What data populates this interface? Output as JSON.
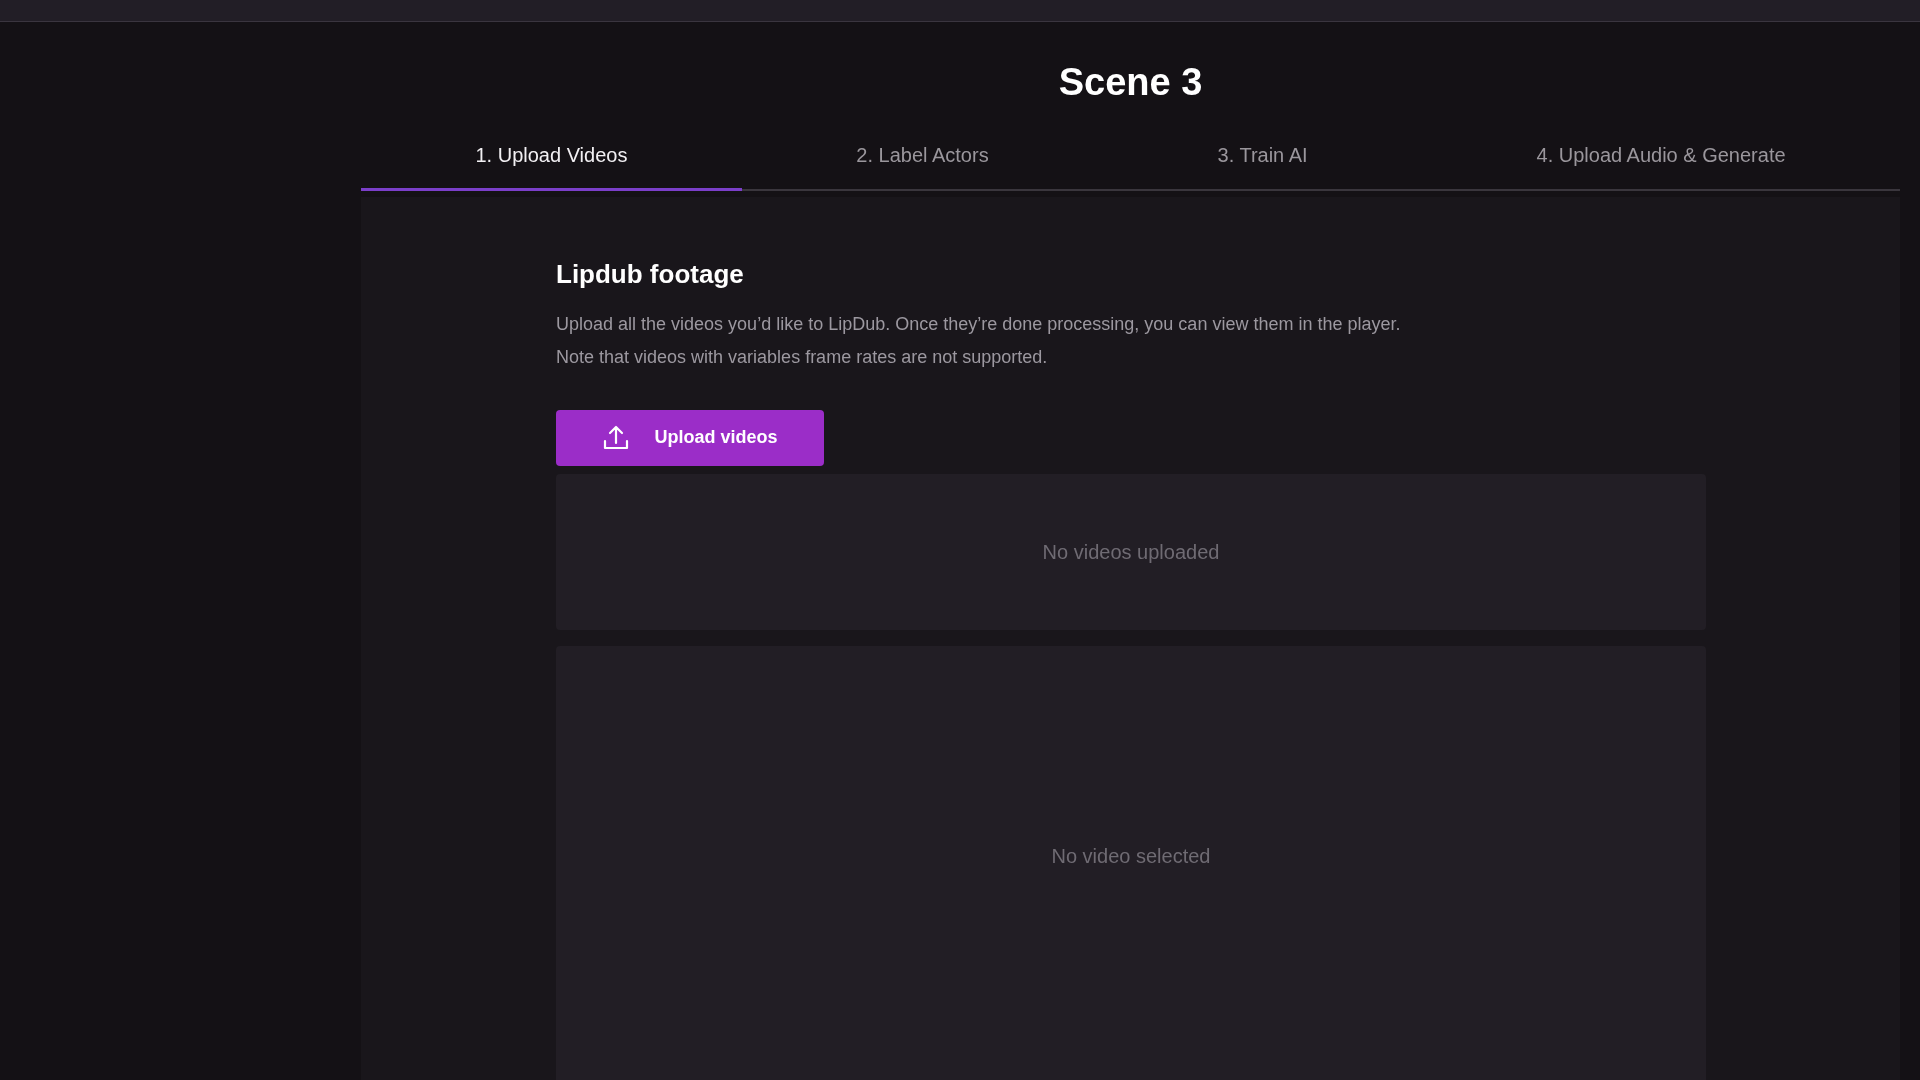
{
  "title": "Scene 3",
  "tabs": [
    {
      "label": "1. Upload Videos",
      "selected": true
    },
    {
      "label": "2. Label Actors",
      "selected": false
    },
    {
      "label": "3. Train AI",
      "selected": false
    },
    {
      "label": "4. Upload Audio & Generate",
      "selected": false
    }
  ],
  "section": {
    "heading": "Lipdub footage",
    "description": [
      "Upload all the videos you’d like to LipDub. Once they’re done processing, you can view them in the player.",
      "Note that videos with variables frame rates are not supported."
    ],
    "upload_button": "Upload videos"
  },
  "video_list": {
    "empty_text": "No videos uploaded"
  },
  "player": {
    "empty_text": "No video selected"
  }
}
